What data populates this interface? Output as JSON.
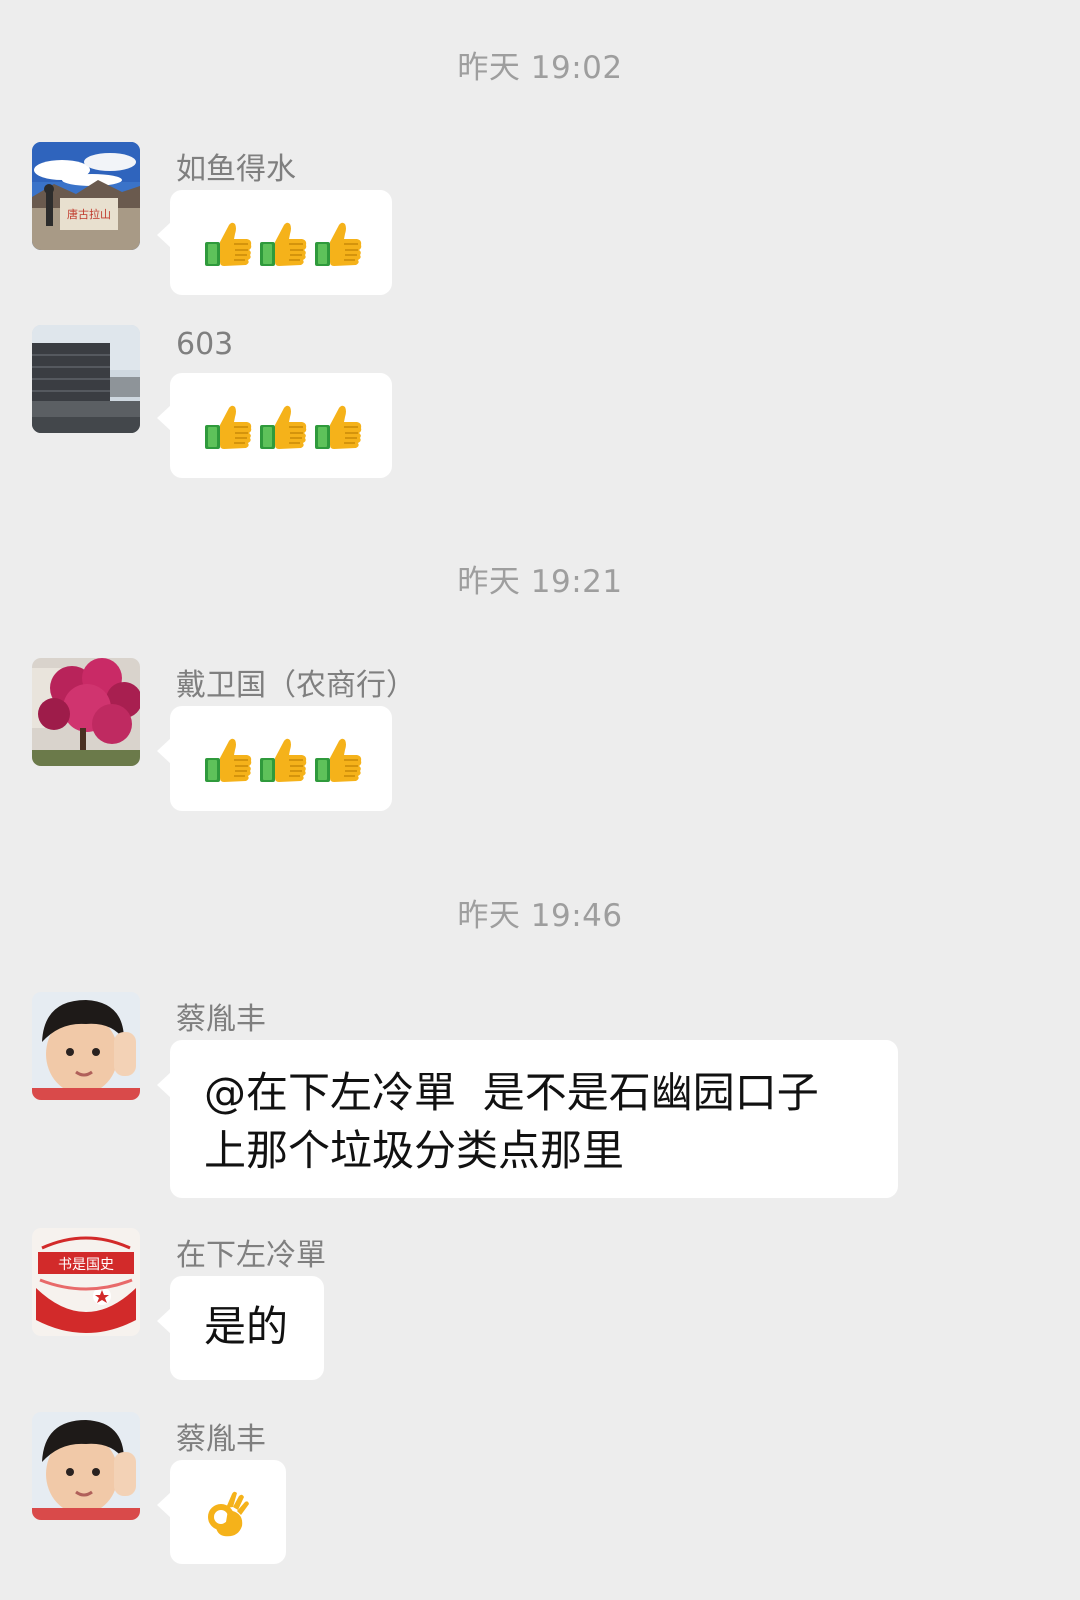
{
  "timestamps": [
    "昨天 19:02",
    "昨天 19:21",
    "昨天 19:46"
  ],
  "messages": [
    {
      "sender": "如鱼得水",
      "content_type": "emoji",
      "emoji": [
        "thumbs-up-icon",
        "thumbs-up-icon",
        "thumbs-up-icon"
      ]
    },
    {
      "sender": "603",
      "content_type": "emoji",
      "emoji": [
        "thumbs-up-icon",
        "thumbs-up-icon",
        "thumbs-up-icon"
      ]
    },
    {
      "sender": "戴卫国（农商行）",
      "content_type": "emoji",
      "emoji": [
        "thumbs-up-icon",
        "thumbs-up-icon",
        "thumbs-up-icon"
      ]
    },
    {
      "sender": "蔡胤丰",
      "content_type": "text",
      "text": "@在下左冷單  是不是石幽园口子\n上那个垃圾分类点那里"
    },
    {
      "sender": "在下左冷單",
      "content_type": "text",
      "text": "是的"
    },
    {
      "sender": "蔡胤丰",
      "content_type": "emoji",
      "emoji": [
        "ok-hand-icon"
      ]
    }
  ],
  "avatar_1_sign_text": "唐古拉山",
  "avatar_5_banner_text": "书是国史"
}
